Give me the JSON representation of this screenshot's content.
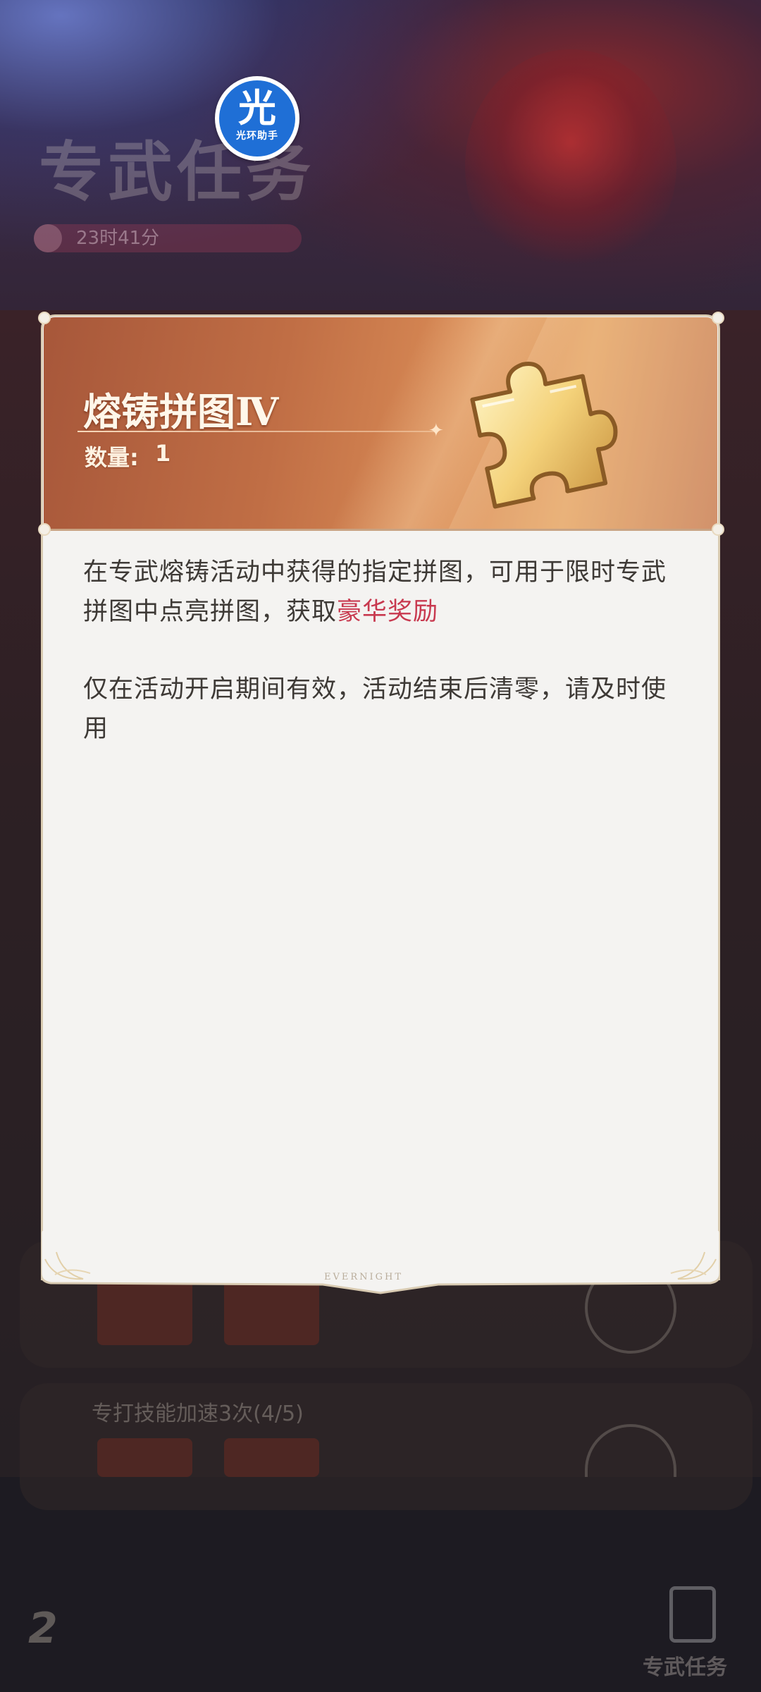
{
  "background": {
    "title": "专武任务",
    "timer": "23时41分",
    "card_label": "专打技能加速3次(4/5)",
    "bottom_nav_label": "专武任务"
  },
  "watermark": {
    "char": "光",
    "text": "光环助手"
  },
  "item": {
    "name": "熔铸拼图Ⅳ",
    "quantity_label": "数量:",
    "quantity_value": "1",
    "icon": "puzzle-piece-icon",
    "desc_p1_part1": "在专武熔铸活动中获得的指定拼图，可用于限时专武拼图中点亮拼图，获取",
    "desc_p1_highlight": "豪华奖励",
    "desc_p2": "仅在活动开启期间有效，活动结束后清零，请及时使用",
    "footer_mark": "EVERNIGHT"
  },
  "colors": {
    "header_start": "#a7573a",
    "header_end": "#e5a86c",
    "highlight": "#c8394f",
    "body_text": "#3e3a36",
    "card_bg": "#f4f3f1",
    "watermark_blue": "#1f6fd6"
  }
}
